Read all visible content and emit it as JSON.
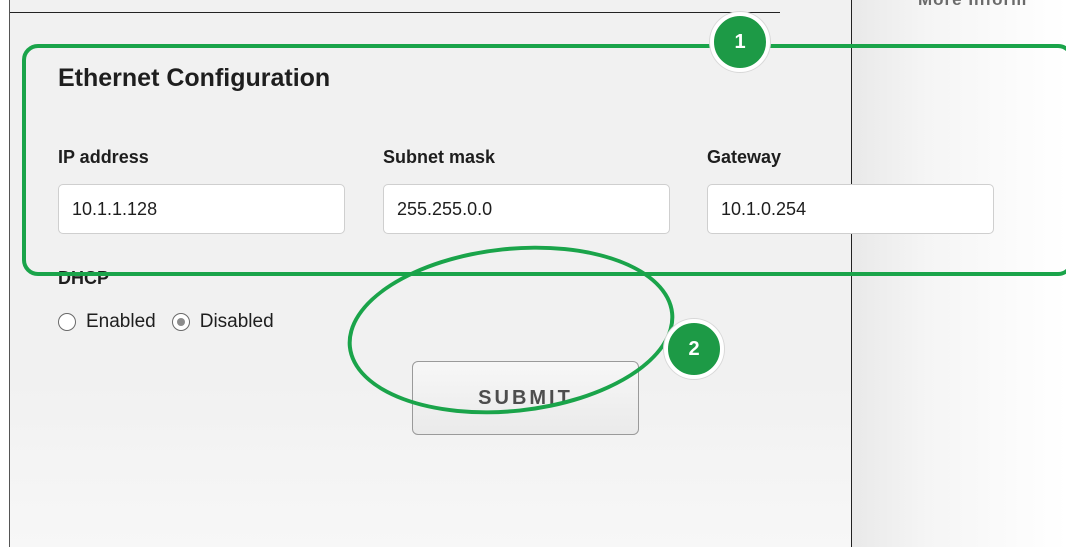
{
  "side_panel": {
    "link_text": "More Inform"
  },
  "ethernet": {
    "title": "Ethernet Configuration",
    "ip_label": "IP address",
    "ip_value": "10.1.1.128",
    "subnet_label": "Subnet mask",
    "subnet_value": "255.255.0.0",
    "gateway_label": "Gateway",
    "gateway_value": "10.1.0.254"
  },
  "dhcp": {
    "label": "DHCP",
    "options": [
      {
        "label": "Enabled",
        "selected": false
      },
      {
        "label": "Disabled",
        "selected": true
      }
    ]
  },
  "form": {
    "submit_label": "SUBMIT"
  },
  "annotations": {
    "badge_1": "1",
    "badge_2": "2",
    "color": "#1aa44a"
  }
}
